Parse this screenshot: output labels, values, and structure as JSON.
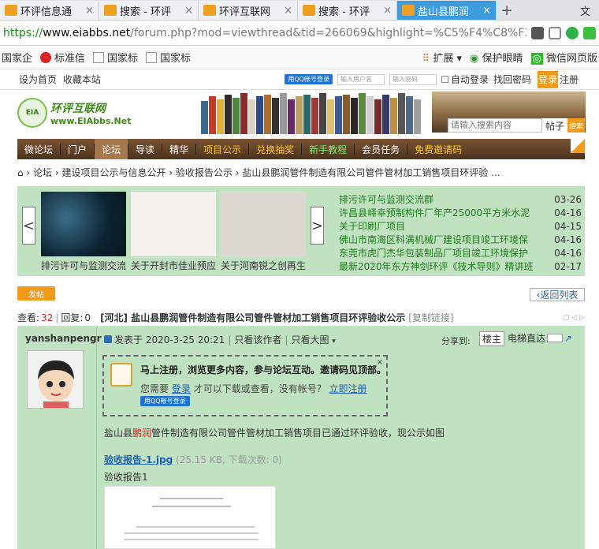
{
  "browser": {
    "tabs": [
      {
        "label": "环评信息通"
      },
      {
        "label": "搜索 - 环评"
      },
      {
        "label": "环评互联网"
      },
      {
        "label": "搜索 - 环评"
      },
      {
        "label": "盐山县鹏润"
      }
    ],
    "new_tab": "+",
    "overflow": "文",
    "url_scheme": "https://",
    "url_domain": "www.eiabbs.net",
    "url_path": "/forum.php?mod=viewthread&tid=266069&highlight=%C5%F4%C8%F3",
    "bookmarks": [
      "国家企",
      "标准信",
      "国家标",
      "国家标"
    ],
    "extensions": [
      "扩展",
      "保护眼睛",
      "微信网页版"
    ]
  },
  "site": {
    "topbar": {
      "set_home": "设为首页",
      "bookmark": "收藏本站",
      "qq_login": "用QQ帐号登录",
      "user_placeholder": "输入用户名",
      "password_placeholder": "输入密码",
      "auto_login": "自动登录",
      "forgot": "找回密码",
      "login": "登录",
      "register": "注册"
    },
    "logo_text": "环评互联网",
    "logo_url": "www.EIAbbs.Net",
    "logo_badge": "EIA",
    "search_placeholder": "请输入搜索内容",
    "search_type": "帖子",
    "search_button": "搜索",
    "nav": [
      {
        "label": "微论坛",
        "style": "normal"
      },
      {
        "label": "门户",
        "style": "normal"
      },
      {
        "label": "论坛",
        "style": "current"
      },
      {
        "label": "导读",
        "style": "normal"
      },
      {
        "label": "精华",
        "style": "normal"
      },
      {
        "label": "项目公示",
        "style": "yellow"
      },
      {
        "label": "兑换抽奖",
        "style": "yellow"
      },
      {
        "label": "新手教程",
        "style": "green"
      },
      {
        "label": "会员任务",
        "style": "normal"
      },
      {
        "label": "免费邀请码",
        "style": "yellow"
      }
    ],
    "breadcrumb": "⌂ › 论坛 › 建设项目公示与信息公开 › 验收报告公示 › 盐山县鹏润管件制造有限公司管件管材加工销售项目环评验 ..."
  },
  "slider": {
    "captions": [
      "排污许可与监测交流",
      "关于开封市佳业预应",
      "关于河南锐之创再生"
    ],
    "news": [
      {
        "title": "排污许可与监测交流群",
        "date": "03-26"
      },
      {
        "title": "许昌县峄幸预制构件厂年产25000平方米水泥",
        "date": "04-16"
      },
      {
        "title": "关于印刷厂项目",
        "date": "04-15"
      },
      {
        "title": "佛山市南海区科满机械厂建设项目竣工环境保",
        "date": "04-16"
      },
      {
        "title": "东莞市虎门杰华包装制品厂项目竣工环境保护",
        "date": "04-16"
      },
      {
        "title": "最新2020年东方神剑环评《技术导则》精讲班",
        "date": "02-17"
      }
    ]
  },
  "thread": {
    "post_button": "发帖",
    "back_button": "‹返回列表",
    "views_label": "查看:",
    "views": "32",
    "replies_label": "回复:",
    "replies": "0",
    "title": "[河北] 盐山县鹏润管件制造有限公司管件管材加工销售项目环评验收公示",
    "copy_link": "[复制链接]",
    "author": "yanshanpengr",
    "posted": "发表于 2020-3-25 20:21",
    "only_author": "只看该作者",
    "big_image": "只看大图",
    "share": "分享到:",
    "louzhu": "楼主",
    "elevator": "电梯直达",
    "notice_title": "马上注册，浏览更多内容，参与论坛互动。邀请码见顶部。",
    "notice_sub_before": "您需要",
    "notice_login": "登录",
    "notice_sub_mid": "才可以下载或查看，没有帐号？",
    "notice_register": "立即注册",
    "notice_qq": "用QQ帐号登录",
    "notice_close": "×",
    "body_before": "盐山县",
    "body_highlight": "鹏润",
    "body_after": "管件制造有限公司管件管材加工销售项目已通过环评验收，现公示如图",
    "attachment_name": "验收报告-1.jpg",
    "attachment_info": "(25.15 KB, 下载次数: 0)",
    "attachment_caption": "验收报告1"
  },
  "colors": {
    "accent_orange": "#f29b1a",
    "nav_brown": "#5c3d22",
    "panel_green": "#c1e2c1",
    "link_green": "#1f7a1f"
  }
}
